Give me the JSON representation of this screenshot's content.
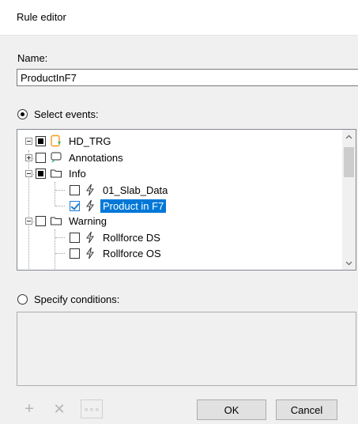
{
  "window": {
    "title": "Rule editor"
  },
  "name": {
    "label": "Name:",
    "value": "ProductInF7"
  },
  "events": {
    "radio_label": "Select events:",
    "root": "HD_TRG",
    "annotations": "Annotations",
    "info": "Info",
    "slab": "01_Slab_Data",
    "product": "Product in F7",
    "warning": "Warning",
    "rf_ds": "Rollforce DS",
    "rf_os": "Rollforce OS"
  },
  "conditions": {
    "radio_label": "Specify conditions:"
  },
  "toolbar": {
    "add": "+",
    "delete": "✕",
    "more": "∘∘∘"
  },
  "buttons": {
    "ok": "OK",
    "cancel": "Cancel"
  },
  "colors": {
    "selection": "#0078d7",
    "check": "#1e7cd8",
    "root_icon": "#f59a1d",
    "annotation_icon": "#3cb371"
  }
}
